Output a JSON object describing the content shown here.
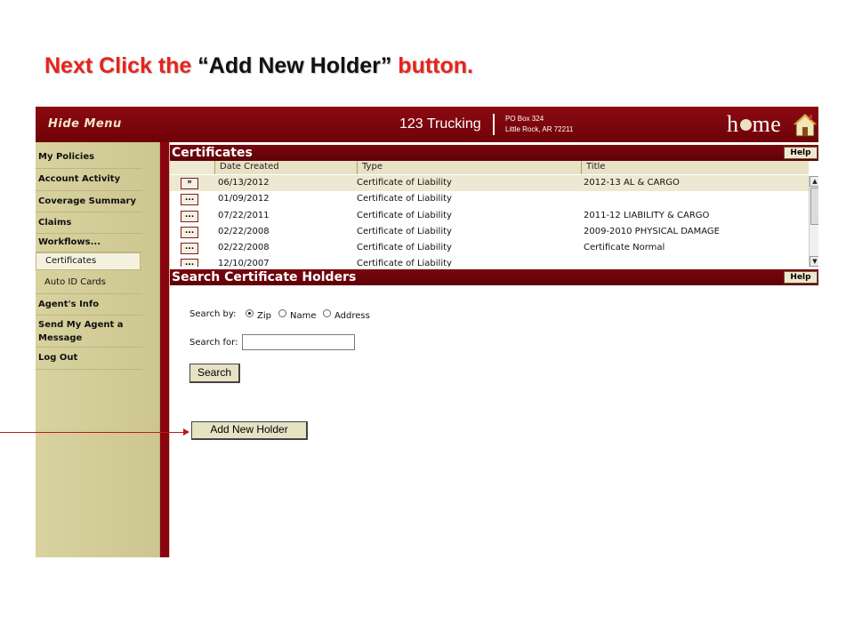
{
  "instruction": {
    "part1": "Next Click the ",
    "quote_open": "“",
    "target": "Add New Holder",
    "quote_close": "”",
    "part2": " button."
  },
  "header": {
    "hide_menu": "Hide Menu",
    "company": "123 Trucking",
    "address_line1": "PO Box 324",
    "address_line2": "Little Rock, AR 72211",
    "logo_h": "h",
    "logo_rest": "me"
  },
  "sidebar": {
    "items": [
      {
        "label": "My Policies"
      },
      {
        "label": "Account Activity"
      },
      {
        "label": "Coverage Summary"
      },
      {
        "label": "Claims"
      },
      {
        "label": "Workflows..."
      },
      {
        "label": "Certificates"
      },
      {
        "label": "Auto ID Cards"
      },
      {
        "label": "Agent's Info"
      },
      {
        "label": "Send My Agent a Message"
      },
      {
        "label": "Log Out"
      }
    ]
  },
  "certificates": {
    "title": "Certificates",
    "help": "Help",
    "columns": [
      "Date Created",
      "Type",
      "Title"
    ],
    "rows": [
      {
        "btn": "»",
        "date": "06/13/2012",
        "type": "Certificate of Liability",
        "title": "2012-13 AL & CARGO"
      },
      {
        "btn": "...",
        "date": "01/09/2012",
        "type": "Certificate of Liability",
        "title": ""
      },
      {
        "btn": "...",
        "date": "07/22/2011",
        "type": "Certificate of Liability",
        "title": "2011-12 LIABILITY & CARGO"
      },
      {
        "btn": "...",
        "date": "02/22/2008",
        "type": "Certificate of Liability",
        "title": "2009-2010 PHYSICAL DAMAGE"
      },
      {
        "btn": "...",
        "date": "02/22/2008",
        "type": "Certificate of Liability",
        "title": "Certificate Normal"
      },
      {
        "btn": "...",
        "date": "12/10/2007",
        "type": "Certificate of Liability",
        "title": ""
      }
    ]
  },
  "search_holders": {
    "title": "Search Certificate Holders",
    "help": "Help",
    "search_by_label": "Search by:",
    "options": [
      "Zip",
      "Name",
      "Address"
    ],
    "selected_option": "Zip",
    "search_for_label": "Search for:",
    "search_for_value": "",
    "search_button": "Search",
    "add_button": "Add New Holder"
  },
  "colors": {
    "accent_red": "#e8231c",
    "header_maroon": "#8c0a12",
    "sidebar_tan": "#d8d29f"
  }
}
